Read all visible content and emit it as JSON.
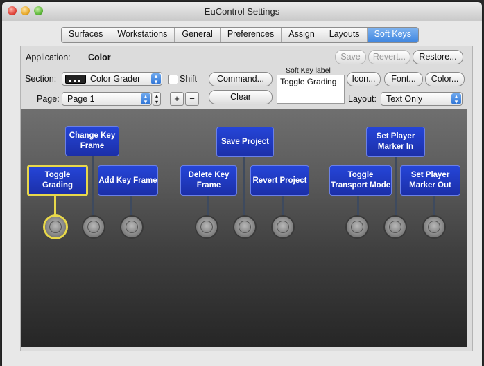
{
  "window": {
    "title": "EuControl Settings"
  },
  "tabs": [
    {
      "label": "Surfaces",
      "active": false
    },
    {
      "label": "Workstations",
      "active": false
    },
    {
      "label": "General",
      "active": false
    },
    {
      "label": "Preferences",
      "active": false
    },
    {
      "label": "Assign",
      "active": false
    },
    {
      "label": "Layouts",
      "active": false
    },
    {
      "label": "Soft Keys",
      "active": true
    }
  ],
  "application": {
    "label": "Application:",
    "value": "Color"
  },
  "actions": {
    "save": "Save",
    "revert": "Revert...",
    "restore": "Restore..."
  },
  "section": {
    "label": "Section:",
    "value": "Color Grader",
    "shift_label": "Shift",
    "shift_checked": false
  },
  "page": {
    "label": "Page:",
    "value": "Page 1",
    "plus": "+",
    "minus": "−"
  },
  "buttons": {
    "command": "Command...",
    "clear": "Clear",
    "icon": "Icon...",
    "font": "Font...",
    "color": "Color..."
  },
  "soft_key_label": {
    "header": "Soft Key label",
    "value": "Toggle Grading"
  },
  "layout": {
    "label": "Layout:",
    "value": "Text Only"
  },
  "keys": {
    "change_key_frame": "Change Key Frame",
    "toggle_grading": "Toggle Grading",
    "add_key_frame": "Add Key Frame",
    "save_project": "Save Project",
    "delete_key_frame": "Delete Key Frame",
    "revert_project": "Revert Project",
    "set_player_marker_in": "Set Player Marker In",
    "toggle_transport_mode": "Toggle Transport Mode",
    "set_player_marker_out": "Set Player Marker Out"
  },
  "colors": {
    "key_blue": "#2141c8",
    "selection_yellow": "#e8d84a",
    "tab_active": "#3f86e0"
  }
}
